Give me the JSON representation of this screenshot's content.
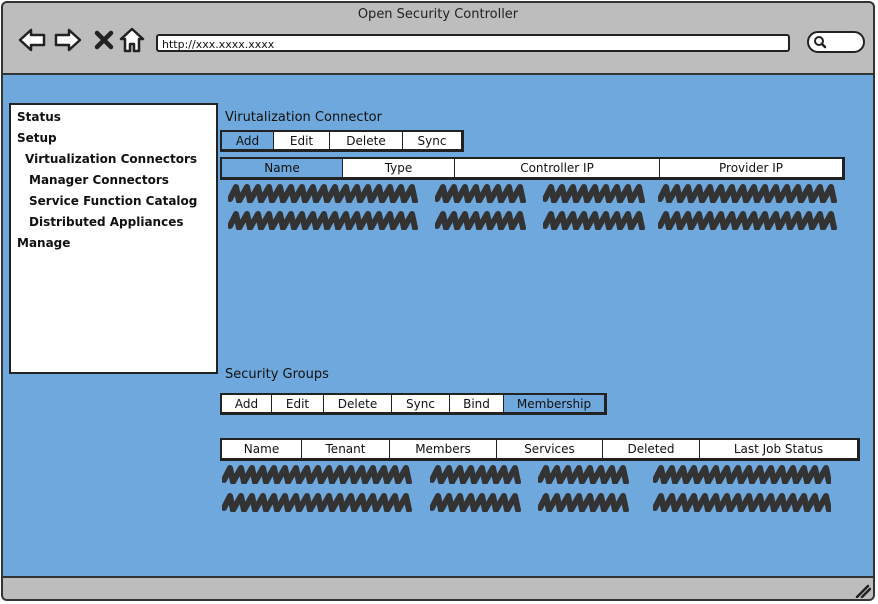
{
  "window": {
    "title": "Open Security Controller"
  },
  "browser": {
    "url": "http://xxx.xxxx.xxxx"
  },
  "sidebar": {
    "items": [
      {
        "label": "Status"
      },
      {
        "label": "Setup"
      },
      {
        "label": "Virtualization Connectors"
      },
      {
        "label": "Manager Connectors"
      },
      {
        "label": "Service Function Catalog"
      },
      {
        "label": "Distributed Appliances"
      },
      {
        "label": "Manage"
      }
    ]
  },
  "vc": {
    "title": "Virutalization Connector",
    "buttons": [
      "Add",
      "Edit",
      "Delete",
      "Sync"
    ],
    "active_button": "Add",
    "columns": [
      "Name",
      "Type",
      "Controller IP",
      "Provider IP"
    ],
    "sorted_column": "Name",
    "row_count": 2
  },
  "sg": {
    "title": "Security Groups",
    "buttons": [
      "Add",
      "Edit",
      "Delete",
      "Sync",
      "Bind",
      "Membership"
    ],
    "active_button": "Membership",
    "columns": [
      "Name",
      "Tenant",
      "Members",
      "Services",
      "Deleted",
      "Last Job Status"
    ],
    "row_count": 2
  },
  "colors": {
    "content_bg": "#6fa8dc",
    "chrome_bg": "#bdbdbd",
    "highlight": "#6fa8dc",
    "scribble": "#333333"
  },
  "icons": [
    "back-arrow-icon",
    "forward-arrow-icon",
    "close-icon",
    "home-icon",
    "search-icon",
    "resize-grip-icon"
  ]
}
